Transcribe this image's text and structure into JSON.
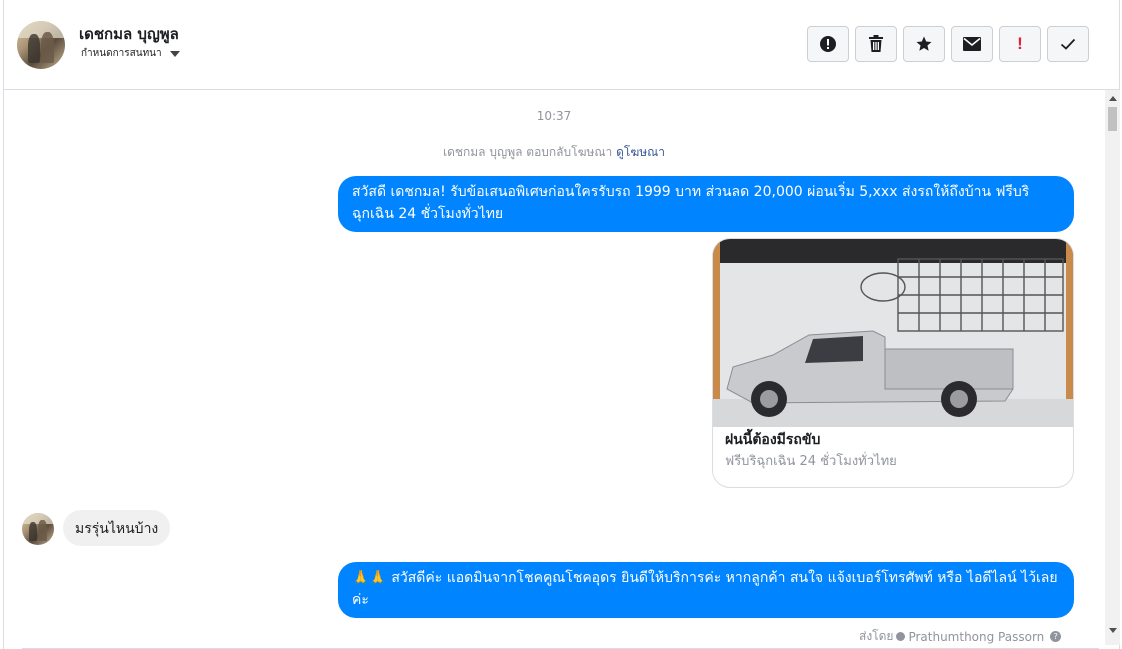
{
  "header": {
    "contact_name": "เดชกมล บุญพูล",
    "assign_label": "กำหนดการสนทนา",
    "actions": [
      {
        "name": "spam-button",
        "icon": "exclamation-circle-icon"
      },
      {
        "name": "delete-button",
        "icon": "trash-icon"
      },
      {
        "name": "star-button",
        "icon": "star-icon"
      },
      {
        "name": "mark-unread-button",
        "icon": "envelope-icon"
      },
      {
        "name": "follow-up-button",
        "icon": "red-exclamation-icon",
        "label": "!",
        "color": "#e41e3f"
      },
      {
        "name": "mark-done-button",
        "icon": "check-icon"
      }
    ]
  },
  "thread": {
    "timestamp": "10:37",
    "ad_reply": {
      "text": "เดชกมล บุญพูล ตอบกลับโฆษณา",
      "link": "ดูโฆษณา"
    },
    "messages": [
      {
        "from": "page",
        "text": "สวัสดี เดชกมล! รับข้อเสนอพิเศษก่อนใครรับรถ 1999 บาท ส่วนลด 20,000  ผ่อนเริ่ม 5,xxx ส่งรถให้ถึงบ้าน ฟรีบริฉุกเฉิน 24 ชั่วโมงทั่วไทย"
      },
      {
        "from": "user",
        "text": "มรรุ่นไหนบ้าง"
      },
      {
        "from": "page",
        "text": "🙏🙏 สวัสดีค่ะ แอดมินจากโชคคูณโชคอุดร ยินดีให้บริการค่ะ หากลูกค้า สนใจ แจ้งเบอร์โทรศัพท์ หรือ ไอดีไลน์ ไว้เลยค่ะ"
      }
    ],
    "ad_card": {
      "title": "ฝนนี้ต้องมีรถขับ",
      "subtitle": "ฟรีบริฉุกเฉิน 24 ชั่วโมงทั่วไทย"
    },
    "sent_by": {
      "prefix": "ส่งโดย",
      "name": "Prathumthong Passorn"
    }
  },
  "colors": {
    "accent_blue": "#0084ff",
    "incoming_bubble": "#f1f0f0",
    "link": "#385898",
    "muted": "#90949c",
    "danger": "#e41e3f"
  }
}
